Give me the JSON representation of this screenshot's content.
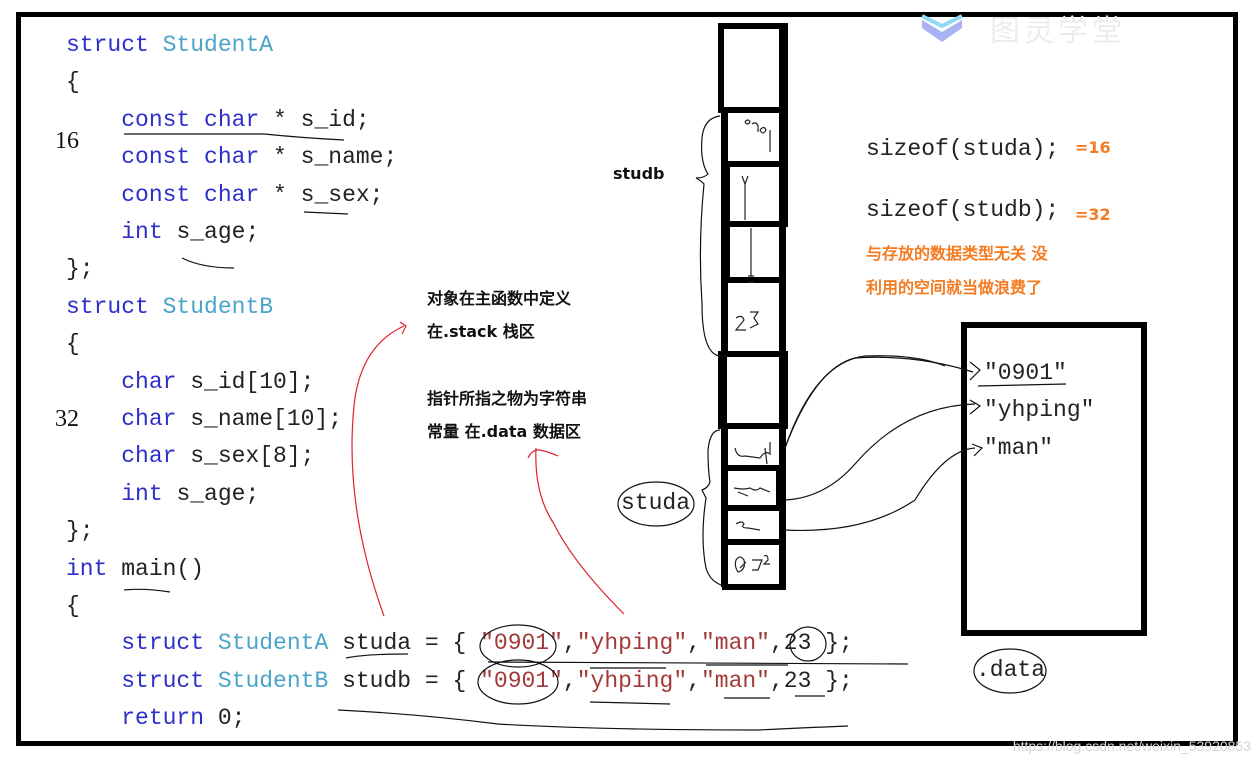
{
  "code": {
    "lines": [
      {
        "parts": [
          {
            "t": "struct ",
            "c": "kw"
          },
          {
            "t": "StudentA",
            "c": "ty"
          }
        ]
      },
      {
        "parts": [
          {
            "t": "{",
            "c": "num"
          }
        ]
      },
      {
        "parts": [
          {
            "t": "    ",
            "c": "num"
          },
          {
            "t": "const char",
            "c": "kw"
          },
          {
            "t": " * s_id;",
            "c": "num"
          }
        ]
      },
      {
        "parts": [
          {
            "t": "    ",
            "c": "num"
          },
          {
            "t": "const char",
            "c": "kw"
          },
          {
            "t": " * s_name;",
            "c": "num"
          }
        ]
      },
      {
        "parts": [
          {
            "t": "    ",
            "c": "num"
          },
          {
            "t": "const char",
            "c": "kw"
          },
          {
            "t": " * s_sex;",
            "c": "num"
          }
        ]
      },
      {
        "parts": [
          {
            "t": "    ",
            "c": "num"
          },
          {
            "t": "int",
            "c": "kw"
          },
          {
            "t": " s_age;",
            "c": "num"
          }
        ]
      },
      {
        "parts": [
          {
            "t": "};",
            "c": "num"
          }
        ]
      },
      {
        "parts": [
          {
            "t": "struct ",
            "c": "kw"
          },
          {
            "t": "StudentB",
            "c": "ty"
          }
        ]
      },
      {
        "parts": [
          {
            "t": "{",
            "c": "num"
          }
        ]
      },
      {
        "parts": [
          {
            "t": "    ",
            "c": "num"
          },
          {
            "t": "char",
            "c": "kw"
          },
          {
            "t": " s_id[10];",
            "c": "num"
          }
        ]
      },
      {
        "parts": [
          {
            "t": "    ",
            "c": "num"
          },
          {
            "t": "char",
            "c": "kw"
          },
          {
            "t": " s_name[10];",
            "c": "num"
          }
        ]
      },
      {
        "parts": [
          {
            "t": "    ",
            "c": "num"
          },
          {
            "t": "char",
            "c": "kw"
          },
          {
            "t": " s_sex[8];",
            "c": "num"
          }
        ]
      },
      {
        "parts": [
          {
            "t": "    ",
            "c": "num"
          },
          {
            "t": "int",
            "c": "kw"
          },
          {
            "t": " s_age;",
            "c": "num"
          }
        ]
      },
      {
        "parts": [
          {
            "t": "};",
            "c": "num"
          }
        ]
      },
      {
        "parts": [
          {
            "t": "int",
            "c": "kw"
          },
          {
            "t": " main()",
            "c": "num"
          }
        ]
      },
      {
        "parts": [
          {
            "t": "{",
            "c": "num"
          }
        ]
      },
      {
        "parts": [
          {
            "t": "    ",
            "c": "num"
          },
          {
            "t": "struct ",
            "c": "kw"
          },
          {
            "t": "StudentA",
            "c": "ty"
          },
          {
            "t": " studa = { ",
            "c": "num"
          },
          {
            "t": "\"0901\"",
            "c": "st"
          },
          {
            "t": ",",
            "c": "num"
          },
          {
            "t": "\"yhping\"",
            "c": "st"
          },
          {
            "t": ",",
            "c": "num"
          },
          {
            "t": "\"man\"",
            "c": "st"
          },
          {
            "t": ",23 };",
            "c": "num"
          }
        ]
      },
      {
        "parts": [
          {
            "t": "    ",
            "c": "num"
          },
          {
            "t": "struct ",
            "c": "kw"
          },
          {
            "t": "StudentB",
            "c": "ty"
          },
          {
            "t": " studb = { ",
            "c": "num"
          },
          {
            "t": "\"0901\"",
            "c": "st"
          },
          {
            "t": ",",
            "c": "num"
          },
          {
            "t": "\"yhping\"",
            "c": "st"
          },
          {
            "t": ",",
            "c": "num"
          },
          {
            "t": "\"man\"",
            "c": "st"
          },
          {
            "t": ",23 };",
            "c": "num"
          }
        ]
      },
      {
        "parts": [
          {
            "t": "    ",
            "c": "num"
          },
          {
            "t": "return",
            "c": "kw"
          },
          {
            "t": " 0;",
            "c": "num"
          }
        ]
      }
    ]
  },
  "side_numbers": {
    "a": "16",
    "b": "32"
  },
  "notes": {
    "stack_note_1": "对象在主函数中定义",
    "stack_note_2": "在.stack 栈区",
    "data_note_1": "指针所指之物为字符串",
    "data_note_2": "常量 在.data 数据区",
    "studb_label": "studb",
    "studa_label": "studa",
    "data_label": ".data"
  },
  "sizeof": {
    "a_expr": "sizeof(studa);",
    "a_val": "=16",
    "b_expr": "sizeof(studb);",
    "b_val": "=32",
    "explain_1": "与存放的数据类型无关 没",
    "explain_2": "利用的空间就当做浪费了"
  },
  "data_segment": {
    "strings": [
      "\"0901\"",
      "\"yhping\"",
      "\"man\""
    ]
  },
  "stack_cells": {
    "studb_cell_marks": [
      "0901",
      "y",
      "",
      "23"
    ],
    "studa_cell_marks": [
      "s_id",
      "s_name",
      "s_sex",
      "23"
    ]
  },
  "watermark": {
    "logo_text": "图灵学堂",
    "url": "https://blog.csdn.net/weixin_53920853"
  },
  "colors": {
    "keyword": "#2d2fc9",
    "type": "#4ba4c9",
    "string": "#a33a3a",
    "annotation_orange": "#f37b22",
    "pen_red": "#e0202a"
  }
}
